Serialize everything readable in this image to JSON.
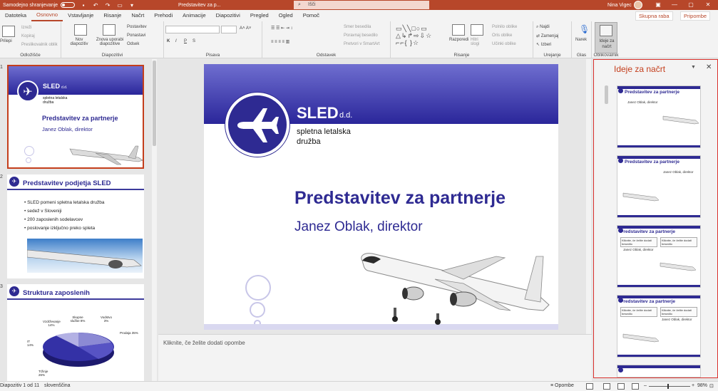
{
  "titlebar": {
    "autosave": "Samodejno shranjevanje",
    "doc_title": "Predstavitev za p...",
    "search": "Išči",
    "user": "Nina Vigec",
    "min": "—",
    "restore": "▢",
    "close": "✕"
  },
  "tabs": [
    "Datoteka",
    "Osnovno",
    "Vstavljanje",
    "Risanje",
    "Načrt",
    "Prehodi",
    "Animacije",
    "Diapozitivi",
    "Pregled",
    "Ogled",
    "Pomoč"
  ],
  "share": "Skupna raba",
  "comments": "Pripombe",
  "ribbon": {
    "clipboard": {
      "paste": "Prilepi",
      "cut": "Izreži",
      "copy": "Kopiraj",
      "format": "Preslikovalnik oblik",
      "label": "Odložišče"
    },
    "slides": {
      "new": "Nov diapozitiv",
      "reuse": "Znova uporabi diapozitive",
      "layout": "Postavitev",
      "reset": "Ponastavi",
      "section": "Odsek",
      "label": "Diapozitivi"
    },
    "font": {
      "label": "Pisava",
      "bold": "K",
      "italic": "I",
      "underline": "P",
      "strike": "S"
    },
    "paragraph": {
      "direction": "Smer besedila",
      "align": "Poravnaj besedilo",
      "smartart": "Pretvori v SmartArt",
      "label": "Odstavek"
    },
    "drawing": {
      "arrange": "Razporedi",
      "styles": "Hitri slogi",
      "fill": "Polnilo oblike",
      "outline": "Oris oblike",
      "effects": "Učinki oblike",
      "label": "Risanje"
    },
    "editing": {
      "find": "Najdi",
      "replace": "Zamenjaj",
      "select": "Izberi",
      "label": "Urejanje"
    },
    "voice": {
      "dictate": "Narek",
      "label": "Glas"
    },
    "designer": {
      "ideas": "Ideje za načrt",
      "label": "Oblikovalnik"
    }
  },
  "thumbnails": [
    {
      "num": "1",
      "title": "Predstavitev za partnerje",
      "sub": "Janez Oblak, direktor",
      "brand": "SLED",
      "brand_suffix": "d.d.",
      "tagline": "spletna letalska družba"
    },
    {
      "num": "2",
      "title": "Predstavitev podjetja SLED",
      "bullets": [
        "SLED pomeni spletna letalska družba",
        "sedež v Sloveniji",
        "200 zaposlenih sodelavcev",
        "poslovanje izključno preko spleta"
      ]
    },
    {
      "num": "3",
      "title": "Struktura zaposlenih",
      "labels": [
        "Skupne službe 8%",
        "Vodstvo 3%",
        "Vzdrževanje 14%",
        "IT 14%",
        "Prodaja 35%",
        "Tržinje 26%"
      ]
    }
  ],
  "slide": {
    "brand": "SLED",
    "brand_suffix": "d.d.",
    "tagline_1": "spletna letalska",
    "tagline_2": "družba",
    "title": "Predstavitev za partnerje",
    "subtitle": "Janez Oblak, direktor"
  },
  "notes_placeholder": "Kliknite, če želite dodati opombe",
  "design_pane": {
    "title": "Ideje za načrt",
    "ideas": [
      {
        "title": "Predstavitev za partnerje",
        "sub": "Janez Oblak, direktor"
      },
      {
        "title": "Predstavitev za partnerje",
        "sub": "Janez Oblak, direktor"
      },
      {
        "title": "Predstavitev za partnerje",
        "sub": "Janez Oblak, direktor",
        "box1": "Kliknite, če želite dodati besedilo",
        "box2": "Kliknite, če želite dodati besedilo"
      },
      {
        "title": "Predstavitev za partnerje",
        "sub": "Janez Oblak, direktor",
        "box1": "Kliknite, če želite dodati besedilo",
        "box2": "Kliknite, če želite dodati besedilo"
      }
    ]
  },
  "statusbar": {
    "slide_count": "Diapozitiv 1 od 11",
    "language": "slovenščina",
    "notes": "Opombe",
    "zoom": "98%"
  },
  "colors": {
    "accent": "#b7472a",
    "brand": "#2e2a92",
    "pane_border": "#d9302c"
  }
}
